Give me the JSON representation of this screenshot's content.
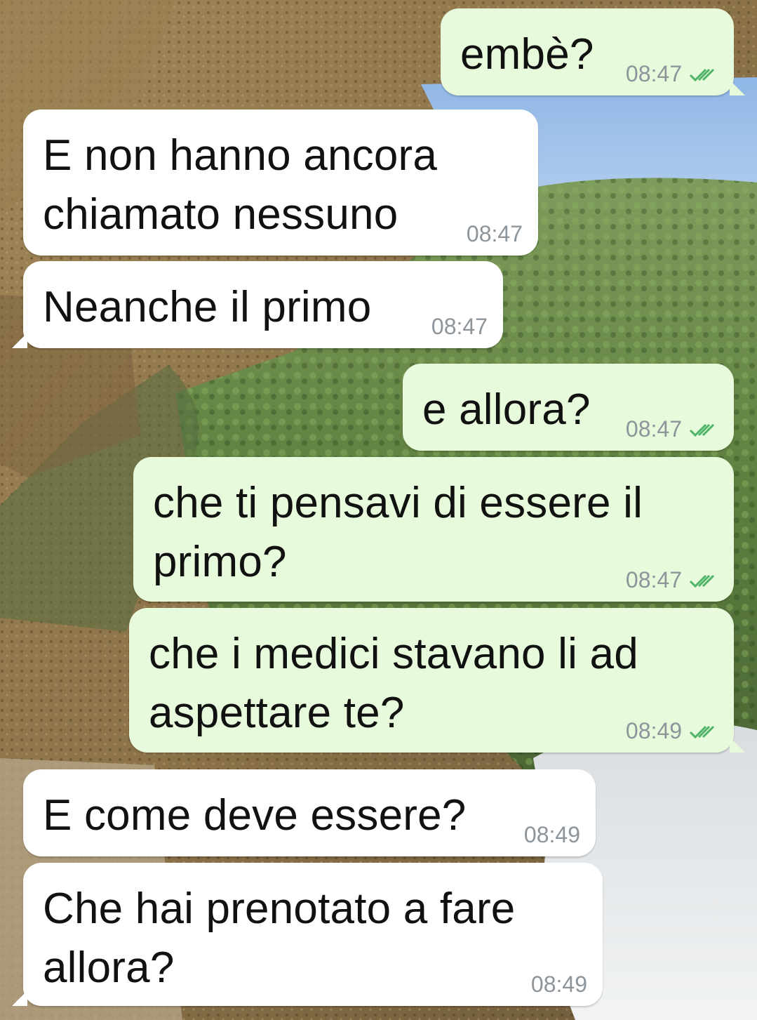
{
  "chat": {
    "messages": [
      {
        "direction": "out",
        "text": "embè?",
        "time": "08:47",
        "status": "double-check-icon"
      },
      {
        "direction": "in",
        "text": "E non hanno ancora\nchiamato nessuno",
        "time": "08:47"
      },
      {
        "direction": "in",
        "text": "Neanche il primo",
        "time": "08:47"
      },
      {
        "direction": "out",
        "text": "e allora?",
        "time": "08:47",
        "status": "double-check-icon"
      },
      {
        "direction": "out",
        "text": "che ti pensavi di essere il\nprimo?",
        "time": "08:47",
        "status": "double-check-icon"
      },
      {
        "direction": "out",
        "text": "che i medici stavano li ad\naspettare te?",
        "time": "08:49",
        "status": "double-check-icon"
      },
      {
        "direction": "in",
        "text": "E come deve essere?",
        "time": "08:49"
      },
      {
        "direction": "in",
        "text": "Che hai prenotato a fare\nallora?",
        "time": "08:49"
      }
    ]
  },
  "colors": {
    "incoming_bubble": "#ffffff",
    "outgoing_bubble": "#e7fbdc",
    "timestamp": "#8d949a",
    "read_ticks": "#4fb36a"
  }
}
